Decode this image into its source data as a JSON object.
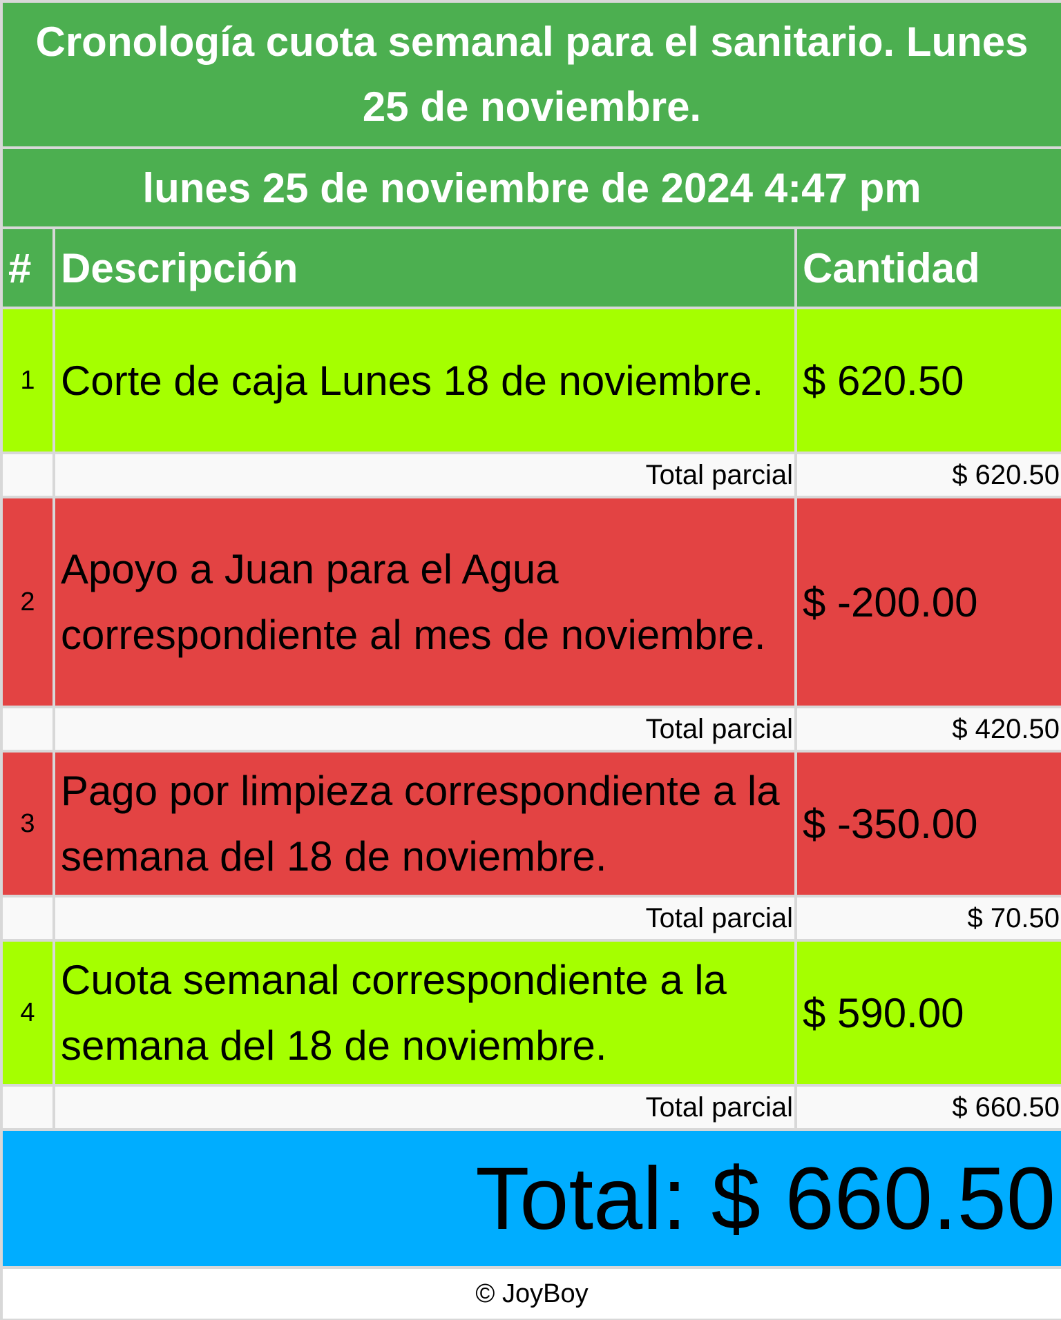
{
  "title": "Cronología cuota semanal para el sanitario. Lunes 25 de noviembre.",
  "datetime": "lunes 25 de noviembre de 2024 4:47 pm",
  "columns": {
    "number": "#",
    "description": "Descripción",
    "amount": "Cantidad"
  },
  "items": [
    {
      "number": "1",
      "description": "Corte de caja Lunes 18 de noviembre.",
      "amount": "$ 620.50",
      "subtotal_label": "Total parcial",
      "subtotal": "$ 620.50",
      "row_color": "#a5ff00"
    },
    {
      "number": "2",
      "description": "Apoyo a Juan para el Agua correspondiente al mes de noviembre.",
      "amount": "$ -200.00",
      "subtotal_label": "Total parcial",
      "subtotal": "$ 420.50",
      "row_color": "#e34343"
    },
    {
      "number": "3",
      "description": "Pago por limpieza correspondiente a la semana del 18 de noviembre.",
      "amount": "$ -350.00",
      "subtotal_label": "Total parcial",
      "subtotal": "$ 70.50",
      "row_color": "#e34343"
    },
    {
      "number": "4",
      "description": "Cuota semanal correspondiente a la semana del 18 de noviembre.",
      "amount": "$ 590.00",
      "subtotal_label": "Total parcial",
      "subtotal": "$ 660.50",
      "row_color": "#a5ff00"
    }
  ],
  "total": "Total: $ 660.50",
  "footer": "© JoyBoy",
  "colors": {
    "header_green": "#4caf50",
    "income_green": "#a5ff00",
    "expense_red": "#e34343",
    "total_blue": "#00adff"
  }
}
